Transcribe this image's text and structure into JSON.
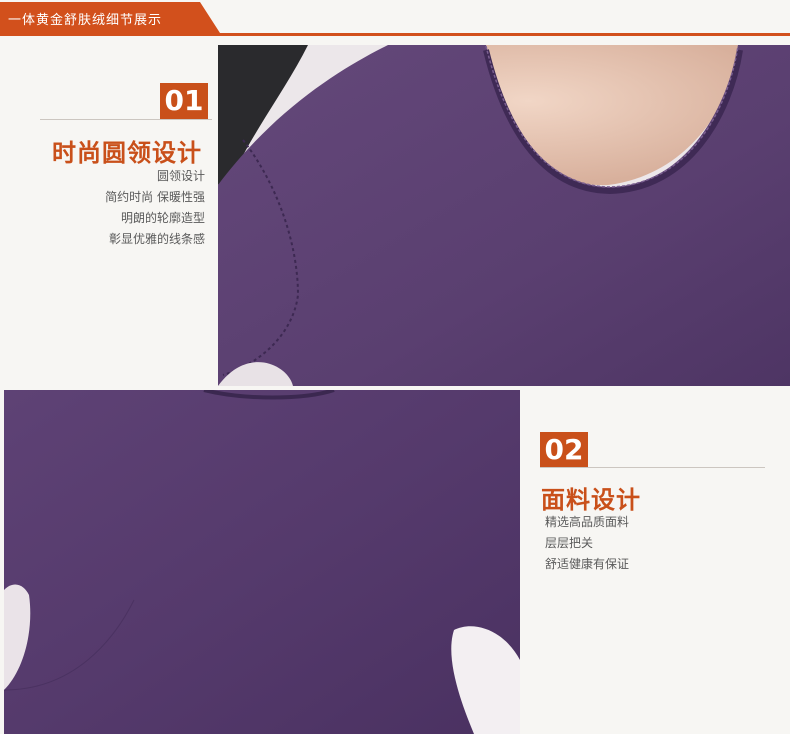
{
  "header": {
    "title": "一体黄金舒肤绒细节展示"
  },
  "section1": {
    "number": "01",
    "title": "时尚圆领设计",
    "lines": [
      "圆领设计",
      "简约时尚  保暖性强",
      "明朗的轮廓造型",
      "彰显优雅的线条感"
    ]
  },
  "section2": {
    "number": "02",
    "title": "面料设计",
    "lines": [
      "精选高品质面料",
      "层层把关",
      "舒适健康有保证"
    ]
  },
  "colors": {
    "accent": "#c9501a",
    "garment": "#5b3f72"
  }
}
